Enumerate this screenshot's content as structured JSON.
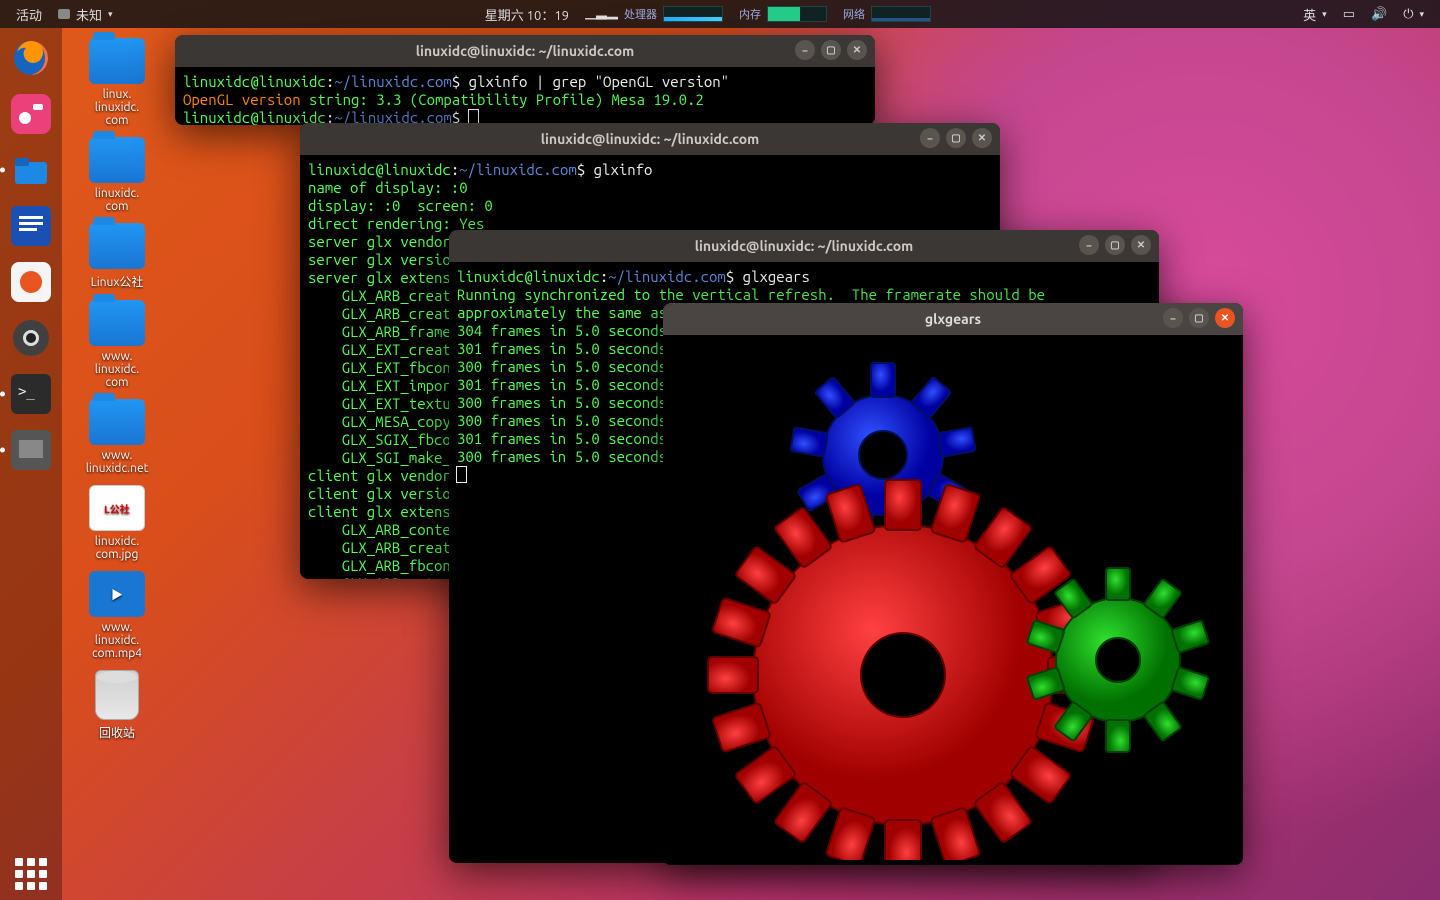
{
  "topbar": {
    "activities": "活动",
    "app_menu": "未知",
    "date": "星期六 10：19",
    "cpu_label": "处理器",
    "mem_label": "内存",
    "net_label": "网络",
    "ime": "英"
  },
  "desktop": [
    {
      "label": "linux.\nlinuxidc.\ncom",
      "kind": "folder"
    },
    {
      "label": "linuxidc.\ncom",
      "kind": "folder"
    },
    {
      "label": "Linux公社",
      "kind": "folder"
    },
    {
      "label": "www.\nlinuxidc.\ncom",
      "kind": "folder"
    },
    {
      "label": "www.\nlinuxidc.net",
      "kind": "folder"
    },
    {
      "label": "linuxidc.\ncom.jpg",
      "kind": "img"
    },
    {
      "label": "www.\nlinuxidc.\ncom.mp4",
      "kind": "vid"
    },
    {
      "label": "回收站",
      "kind": "trash"
    }
  ],
  "windows": {
    "w1": {
      "title": "linuxidc@linuxidc: ~/linuxidc.com",
      "prompt_user": "linuxidc@linuxidc",
      "prompt_path": "~/linuxidc.com",
      "cmd1": "glxinfo | grep \"OpenGL version\"",
      "result1": "OpenGL version string: 3.3 (Compatibility Profile) Mesa 19.0.2"
    },
    "w2": {
      "title": "linuxidc@linuxidc: ~/linuxidc.com",
      "cmd": "glxinfo",
      "lines": [
        "name of display: :0",
        "display: :0  screen: 0",
        "direct rendering: Yes",
        "server glx vendor string: SGI",
        "server glx version",
        "server glx extens",
        "    GLX_ARB_creat",
        "    GLX_ARB_creat",
        "    GLX_ARB_frame",
        "    GLX_EXT_creat",
        "    GLX_EXT_fbcon",
        "    GLX_EXT_impor",
        "    GLX_EXT_textu",
        "    GLX_MESA_copy",
        "    GLX_SGIX_fbco",
        "    GLX_SGI_make_",
        "client glx vendor",
        "client glx versio",
        "client glx extens",
        "    GLX_ARB_conte",
        "    GLX_ARB_creat",
        "    GLX_ARB_fbcon",
        "    GLX_ARB_get_p"
      ]
    },
    "w3": {
      "title": "linuxidc@linuxidc: ~/linuxidc.com",
      "cmd": "glxgears",
      "lines": [
        "Running synchronized to the vertical refresh.  The framerate should be",
        "approximately the same as the monitor refresh rate.",
        "304 frames in 5.0 seconds",
        "301 frames in 5.0 seconds",
        "300 frames in 5.0 seconds",
        "301 frames in 5.0 seconds",
        "300 frames in 5.0 seconds",
        "300 frames in 5.0 seconds",
        "301 frames in 5.0 seconds",
        "300 frames in 5.0 seconds"
      ]
    },
    "w4": {
      "title": "glxgears"
    }
  }
}
